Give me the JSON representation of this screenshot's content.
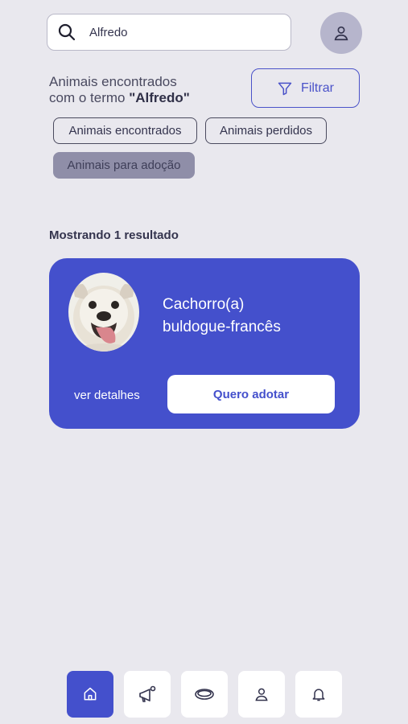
{
  "search": {
    "value": "Alfredo",
    "placeholder": ""
  },
  "results": {
    "line1": "Animais encontrados",
    "line2_prefix": "com o termo ",
    "term": "\"Alfredo\""
  },
  "filter": {
    "label": "Filtrar"
  },
  "chips": [
    {
      "label": "Animais encontrados",
      "active": false
    },
    {
      "label": "Animais perdidos",
      "active": false
    },
    {
      "label": "Animais para adoção",
      "active": true
    }
  ],
  "count_text": "Mostrando 1 resultado",
  "card": {
    "species": "Cachorro(a)",
    "breed": "buldogue-francês",
    "details_label": "ver detalhes",
    "adopt_label": "Quero adotar"
  },
  "nav": [
    {
      "icon": "home-icon",
      "active": true
    },
    {
      "icon": "megaphone-icon",
      "active": false
    },
    {
      "icon": "collar-icon",
      "active": false
    },
    {
      "icon": "user-icon",
      "active": false
    },
    {
      "icon": "bell-icon",
      "active": false
    }
  ],
  "colors": {
    "accent": "#4450cc",
    "background": "#e9e8ee",
    "chip_active": "#8f8ea8"
  }
}
